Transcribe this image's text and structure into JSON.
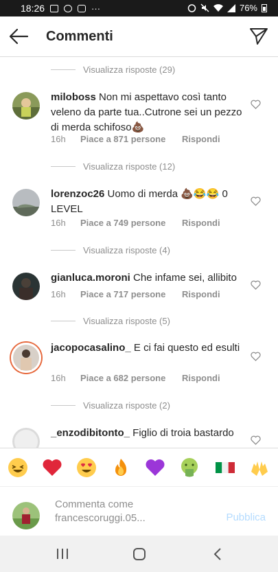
{
  "status_bar": {
    "time": "18:26",
    "more": "···",
    "battery": "76%"
  },
  "header": {
    "title": "Commenti"
  },
  "view_replies": [
    {
      "label": "Visualizza risposte (29)"
    },
    {
      "label": "Visualizza risposte (12)"
    },
    {
      "label": "Visualizza risposte (4)"
    },
    {
      "label": "Visualizza risposte (5)"
    },
    {
      "label": "Visualizza risposte (2)"
    }
  ],
  "comments": [
    {
      "username": "miloboss",
      "text": "Non mi aspettavo così tanto veleno da parte tua..Cutrone sei un pezzo di merda schifoso💩",
      "time": "16h",
      "likes": "Piace a 871 persone",
      "reply": "Rispondi"
    },
    {
      "username": "lorenzoc26",
      "text": "Uomo di merda 💩😂😂 0 LEVEL",
      "time": "16h",
      "likes": "Piace a 749 persone",
      "reply": "Rispondi"
    },
    {
      "username": "gianluca.moroni",
      "text": "Che infame sei, allibito",
      "time": "16h",
      "likes": "Piace a 717 persone",
      "reply": "Rispondi"
    },
    {
      "username": "jacopocasalino_",
      "text": "E ci fai questo ed esulti",
      "time": "16h",
      "likes": "Piace a 682 persone",
      "reply": "Rispondi"
    },
    {
      "username": "_enzodibitonto_",
      "text": "Figlio di troia bastardo"
    }
  ],
  "emoji_bar": [
    {
      "icon": "laughing-emoji-icon"
    },
    {
      "icon": "heart-emoji-icon",
      "color": "#e0263a"
    },
    {
      "icon": "heart-eyes-emoji-icon"
    },
    {
      "icon": "fire-emoji-icon"
    },
    {
      "icon": "purple-heart-emoji-icon",
      "color": "#9b36d8"
    },
    {
      "icon": "vomit-emoji-icon"
    },
    {
      "icon": "italy-flag-icon"
    },
    {
      "icon": "raised-hands-emoji-icon"
    }
  ],
  "composer": {
    "placeholder": "Commenta come francescoruggi.05...",
    "publish": "Pubblica"
  },
  "colors": {
    "link_disabled": "#b3dbff",
    "meta_gray": "#8e8e8e",
    "text": "#262626"
  }
}
